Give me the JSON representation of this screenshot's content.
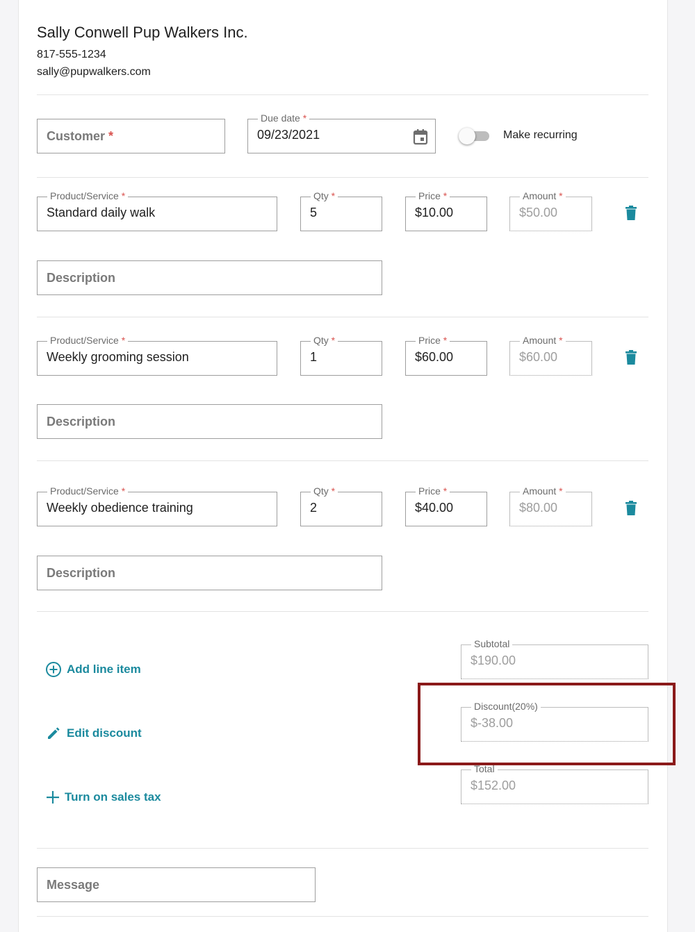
{
  "business": {
    "name": "Sally Conwell Pup Walkers Inc.",
    "phone": "817-555-1234",
    "email": "sally@pupwalkers.com"
  },
  "header": {
    "customer_placeholder": "Customer",
    "required_mark": "*",
    "due_date_label": "Due date",
    "due_date_value": "09/23/2021",
    "recurring_label": "Make recurring",
    "recurring_on": false
  },
  "line_labels": {
    "product": "Product/Service",
    "qty": "Qty",
    "price": "Price",
    "amount": "Amount",
    "description": "Description"
  },
  "line_items": [
    {
      "product": "Standard daily walk",
      "qty": "5",
      "price": "$10.00",
      "amount": "$50.00"
    },
    {
      "product": "Weekly grooming session",
      "qty": "1",
      "price": "$60.00",
      "amount": "$60.00"
    },
    {
      "product": "Weekly obedience training",
      "qty": "2",
      "price": "$40.00",
      "amount": "$80.00"
    }
  ],
  "actions": {
    "add_line_item": "Add line item",
    "edit_discount": "Edit discount",
    "sales_tax": "Turn on sales tax"
  },
  "totals": {
    "subtotal_label": "Subtotal",
    "subtotal": "$190.00",
    "discount_label": "Discount(20%)",
    "discount": "$-38.00",
    "total_label": "Total",
    "total": "$152.00"
  },
  "message_placeholder": "Message",
  "colors": {
    "accent": "#1b8a9e",
    "required": "#d9534f",
    "highlight": "#8b1a1a"
  }
}
